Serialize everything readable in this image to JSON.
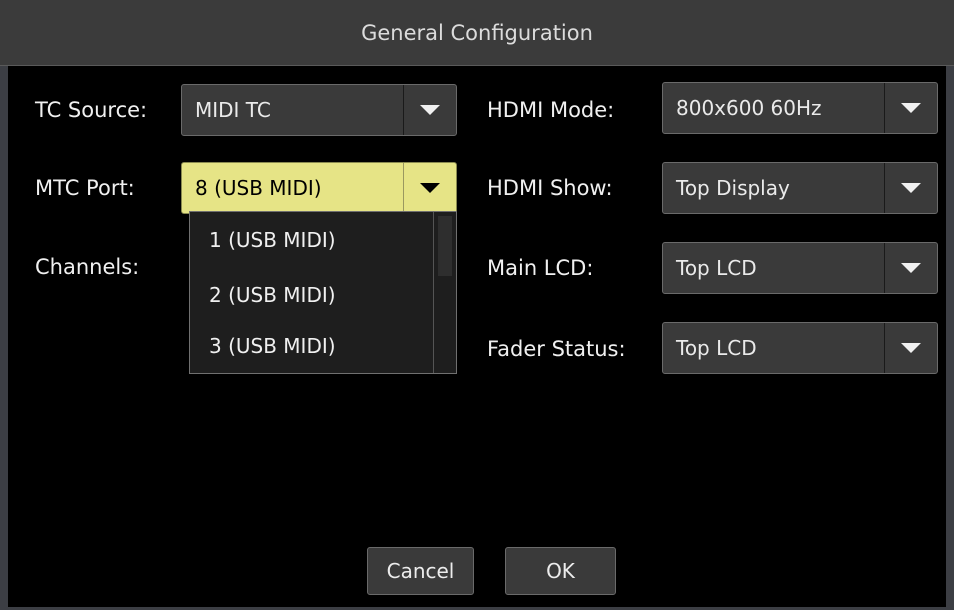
{
  "dialog": {
    "title": "General Configuration"
  },
  "fields": {
    "tc_source": {
      "label": "TC Source:",
      "value": "MIDI TC"
    },
    "mtc_port": {
      "label": "MTC Port:",
      "value": "8 (USB MIDI)"
    },
    "channels": {
      "label": "Channels:"
    },
    "hdmi_mode": {
      "label": "HDMI Mode:",
      "value": "800x600 60Hz"
    },
    "hdmi_show": {
      "label": "HDMI Show:",
      "value": "Top Display"
    },
    "main_lcd": {
      "label": "Main LCD:",
      "value": "Top LCD"
    },
    "fader_status": {
      "label": "Fader Status:",
      "value": "Top LCD"
    }
  },
  "mtc_port_dropdown": {
    "options": [
      "1 (USB MIDI)",
      "2 (USB MIDI)",
      "3 (USB MIDI)"
    ]
  },
  "buttons": {
    "cancel": "Cancel",
    "ok": "OK"
  },
  "colors": {
    "active_dropdown": "#e6e486",
    "control_bg": "#3a3a3a",
    "dialog_bg": "#000000",
    "titlebar_bg": "#3b3b3b"
  },
  "icons": {
    "dropdown_arrow": "chevron-down-icon"
  }
}
